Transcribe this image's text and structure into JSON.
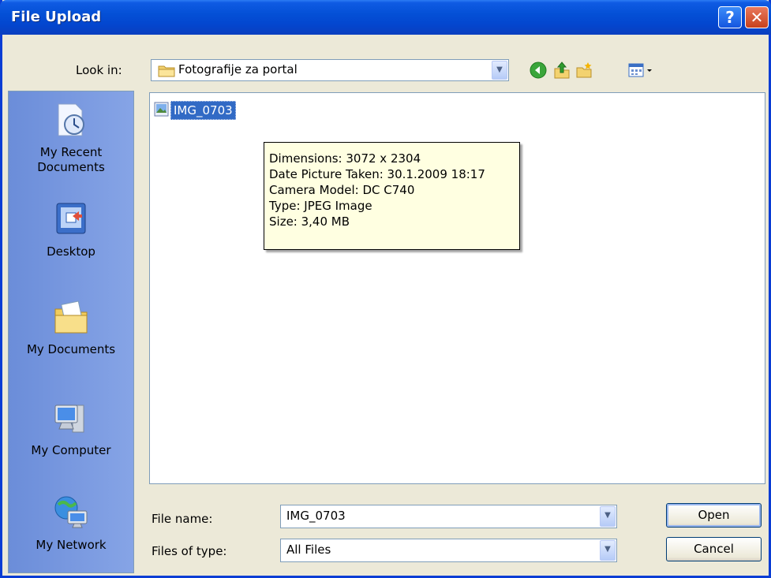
{
  "window": {
    "title": "File Upload",
    "help_label": "?",
    "close_label": "✕"
  },
  "toolbar": {
    "look_in_label": "Look in:",
    "look_in_value": "Fotografije za portal",
    "icons": [
      "back-icon",
      "up-folder-icon",
      "new-folder-icon",
      "views-menu-icon"
    ]
  },
  "places": [
    {
      "label_line1": "My Recent",
      "label_line2": "Documents",
      "icon": "recent-documents-icon"
    },
    {
      "label_line1": "Desktop",
      "label_line2": "",
      "icon": "desktop-icon"
    },
    {
      "label_line1": "My Documents",
      "label_line2": "",
      "icon": "my-documents-icon"
    },
    {
      "label_line1": "My Computer",
      "label_line2": "",
      "icon": "my-computer-icon"
    },
    {
      "label_line1": "My Network",
      "label_line2": "",
      "icon": "my-network-icon"
    }
  ],
  "files": [
    {
      "name": "IMG_0703",
      "icon": "image-file-icon",
      "selected": true
    }
  ],
  "tooltip": {
    "dimensions": "Dimensions: 3072 x 2304",
    "date_taken": "Date Picture Taken: 30.1.2009 18:17",
    "camera": "Camera Model: DC C740",
    "type": "Type: JPEG Image",
    "size": "Size: 3,40 MB"
  },
  "form": {
    "file_name_label": "File name:",
    "file_name_value": "IMG_0703",
    "file_type_label": "Files of type:",
    "file_type_value": "All Files"
  },
  "buttons": {
    "open": "Open",
    "cancel": "Cancel"
  },
  "colors": {
    "title_blue": "#0450d6",
    "selection_blue": "#316ac5",
    "tooltip_bg": "#ffffe1",
    "places_bar": "#7a96df"
  }
}
